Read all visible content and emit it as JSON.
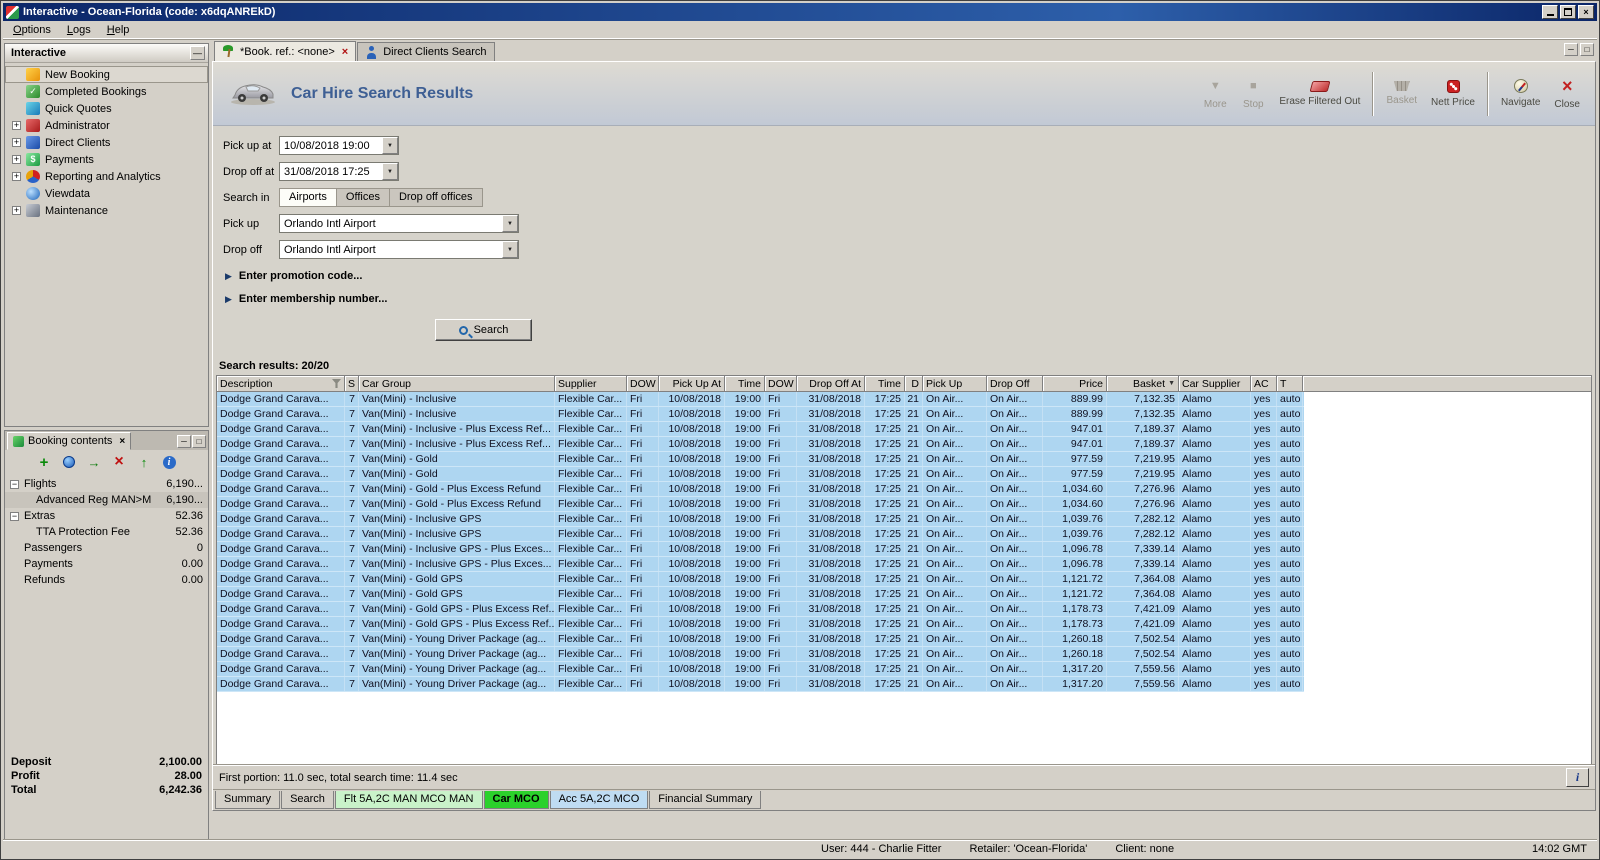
{
  "titlebar": {
    "title": "Interactive - Ocean-Florida (code: x6dqANREkD)"
  },
  "menubar": {
    "items": [
      "Options",
      "Logs",
      "Help"
    ]
  },
  "sidebar": {
    "title": "Interactive",
    "items": [
      {
        "label": "New Booking",
        "icon": "booking-icon",
        "expandable": false,
        "selected": true
      },
      {
        "label": "Completed Bookings",
        "icon": "completed-icon",
        "expandable": false
      },
      {
        "label": "Quick Quotes",
        "icon": "quotes-icon",
        "expandable": false
      },
      {
        "label": "Administrator",
        "icon": "admin-icon",
        "expandable": true
      },
      {
        "label": "Direct Clients",
        "icon": "clients-icon",
        "expandable": true
      },
      {
        "label": "Payments",
        "icon": "payments-icon",
        "expandable": true
      },
      {
        "label": "Reporting and Analytics",
        "icon": "reports-icon",
        "expandable": true
      },
      {
        "label": "Viewdata",
        "icon": "viewdata-icon",
        "expandable": false
      },
      {
        "label": "Maintenance",
        "icon": "maintenance-icon",
        "expandable": true
      }
    ]
  },
  "booking_contents": {
    "title": "Booking contents",
    "toolbar_icons": [
      "add-icon",
      "globe-icon",
      "export-icon",
      "delete-icon",
      "upload-icon",
      "info-icon"
    ],
    "rows": [
      {
        "label": "Flights",
        "value": "6,190...",
        "level": 0,
        "expander": true
      },
      {
        "label": "Advanced Reg MAN>M",
        "value": "6,190...",
        "level": 1,
        "selected": true
      },
      {
        "label": "Extras",
        "value": "52.36",
        "level": 0,
        "expander": true
      },
      {
        "label": "TTA Protection Fee",
        "value": "52.36",
        "level": 1
      },
      {
        "label": "Passengers",
        "value": "0",
        "level": 0
      },
      {
        "label": "Payments",
        "value": "0.00",
        "level": 0
      },
      {
        "label": "Refunds",
        "value": "0.00",
        "level": 0
      }
    ],
    "totals": [
      {
        "label": "Deposit",
        "value": "2,100.00"
      },
      {
        "label": "Profit",
        "value": "28.00"
      },
      {
        "label": "Total",
        "value": "6,242.36"
      }
    ]
  },
  "doc_tabs": [
    {
      "label": "*Book. ref.: <none>",
      "icon": "palm-icon",
      "active": true,
      "closable": true
    },
    {
      "label": "Direct Clients Search",
      "icon": "client-search-icon",
      "active": false,
      "closable": false
    }
  ],
  "header": {
    "title": "Car Hire Search Results",
    "toolbar": [
      {
        "label": "More",
        "icon": "more-icon",
        "disabled": true
      },
      {
        "label": "Stop",
        "icon": "stop-icon",
        "disabled": true
      },
      {
        "label": "Erase Filtered Out",
        "icon": "erase-filter-icon",
        "disabled": false,
        "sep_after": true
      },
      {
        "label": "Basket",
        "icon": "basket-icon",
        "disabled": true
      },
      {
        "label": "Nett Price",
        "icon": "nett-price-icon",
        "disabled": false,
        "sep_after": true
      },
      {
        "label": "Navigate",
        "icon": "navigate-icon",
        "disabled": false
      },
      {
        "label": "Close",
        "icon": "close-icon",
        "disabled": false
      }
    ]
  },
  "form": {
    "pickup_at": {
      "label": "Pick up at",
      "value": "10/08/2018 19:00"
    },
    "dropoff_at": {
      "label": "Drop off at",
      "value": "31/08/2018 17:25"
    },
    "search_in": {
      "label": "Search in",
      "tabs": [
        "Airports",
        "Offices",
        "Drop off offices"
      ],
      "active_tab": "Airports"
    },
    "pickup": {
      "label": "Pick up",
      "value": "Orlando Intl Airport"
    },
    "dropoff": {
      "label": "Drop off",
      "value": "Orlando Intl Airport"
    },
    "promotion_toggle": "Enter promotion code...",
    "membership_toggle": "Enter membership number...",
    "search_button": "Search"
  },
  "results": {
    "summary": "Search results: 20/20",
    "sort_column": "Basket",
    "columns": [
      "Description",
      "S",
      "Car Group",
      "Supplier",
      "DOW",
      "Pick Up At",
      "Time",
      "DOW",
      "Drop Off At",
      "Time",
      "D",
      "Pick Up",
      "Drop Off",
      "Price",
      "Basket",
      "Car Supplier",
      "AC",
      "T"
    ],
    "rows": [
      [
        "Dodge Grand Carava...",
        "7",
        "Van(Mini) - Inclusive",
        "Flexible Car...",
        "Fri",
        "10/08/2018",
        "19:00",
        "Fri",
        "31/08/2018",
        "17:25",
        "21",
        "On Air...",
        "On Air...",
        "889.99",
        "7,132.35",
        "Alamo",
        "yes",
        "auto"
      ],
      [
        "Dodge Grand Carava...",
        "7",
        "Van(Mini) - Inclusive",
        "Flexible Car...",
        "Fri",
        "10/08/2018",
        "19:00",
        "Fri",
        "31/08/2018",
        "17:25",
        "21",
        "On Air...",
        "On Air...",
        "889.99",
        "7,132.35",
        "Alamo",
        "yes",
        "auto"
      ],
      [
        "Dodge Grand Carava...",
        "7",
        "Van(Mini) - Inclusive - Plus Excess Ref...",
        "Flexible Car...",
        "Fri",
        "10/08/2018",
        "19:00",
        "Fri",
        "31/08/2018",
        "17:25",
        "21",
        "On Air...",
        "On Air...",
        "947.01",
        "7,189.37",
        "Alamo",
        "yes",
        "auto"
      ],
      [
        "Dodge Grand Carava...",
        "7",
        "Van(Mini) - Inclusive - Plus Excess Ref...",
        "Flexible Car...",
        "Fri",
        "10/08/2018",
        "19:00",
        "Fri",
        "31/08/2018",
        "17:25",
        "21",
        "On Air...",
        "On Air...",
        "947.01",
        "7,189.37",
        "Alamo",
        "yes",
        "auto"
      ],
      [
        "Dodge Grand Carava...",
        "7",
        "Van(Mini) - Gold",
        "Flexible Car...",
        "Fri",
        "10/08/2018",
        "19:00",
        "Fri",
        "31/08/2018",
        "17:25",
        "21",
        "On Air...",
        "On Air...",
        "977.59",
        "7,219.95",
        "Alamo",
        "yes",
        "auto"
      ],
      [
        "Dodge Grand Carava...",
        "7",
        "Van(Mini) - Gold",
        "Flexible Car...",
        "Fri",
        "10/08/2018",
        "19:00",
        "Fri",
        "31/08/2018",
        "17:25",
        "21",
        "On Air...",
        "On Air...",
        "977.59",
        "7,219.95",
        "Alamo",
        "yes",
        "auto"
      ],
      [
        "Dodge Grand Carava...",
        "7",
        "Van(Mini) - Gold - Plus Excess Refund",
        "Flexible Car...",
        "Fri",
        "10/08/2018",
        "19:00",
        "Fri",
        "31/08/2018",
        "17:25",
        "21",
        "On Air...",
        "On Air...",
        "1,034.60",
        "7,276.96",
        "Alamo",
        "yes",
        "auto"
      ],
      [
        "Dodge Grand Carava...",
        "7",
        "Van(Mini) - Gold - Plus Excess Refund",
        "Flexible Car...",
        "Fri",
        "10/08/2018",
        "19:00",
        "Fri",
        "31/08/2018",
        "17:25",
        "21",
        "On Air...",
        "On Air...",
        "1,034.60",
        "7,276.96",
        "Alamo",
        "yes",
        "auto"
      ],
      [
        "Dodge Grand Carava...",
        "7",
        "Van(Mini) - Inclusive GPS",
        "Flexible Car...",
        "Fri",
        "10/08/2018",
        "19:00",
        "Fri",
        "31/08/2018",
        "17:25",
        "21",
        "On Air...",
        "On Air...",
        "1,039.76",
        "7,282.12",
        "Alamo",
        "yes",
        "auto"
      ],
      [
        "Dodge Grand Carava...",
        "7",
        "Van(Mini) - Inclusive GPS",
        "Flexible Car...",
        "Fri",
        "10/08/2018",
        "19:00",
        "Fri",
        "31/08/2018",
        "17:25",
        "21",
        "On Air...",
        "On Air...",
        "1,039.76",
        "7,282.12",
        "Alamo",
        "yes",
        "auto"
      ],
      [
        "Dodge Grand Carava...",
        "7",
        "Van(Mini) - Inclusive GPS - Plus Exces...",
        "Flexible Car...",
        "Fri",
        "10/08/2018",
        "19:00",
        "Fri",
        "31/08/2018",
        "17:25",
        "21",
        "On Air...",
        "On Air...",
        "1,096.78",
        "7,339.14",
        "Alamo",
        "yes",
        "auto"
      ],
      [
        "Dodge Grand Carava...",
        "7",
        "Van(Mini) - Inclusive GPS - Plus Exces...",
        "Flexible Car...",
        "Fri",
        "10/08/2018",
        "19:00",
        "Fri",
        "31/08/2018",
        "17:25",
        "21",
        "On Air...",
        "On Air...",
        "1,096.78",
        "7,339.14",
        "Alamo",
        "yes",
        "auto"
      ],
      [
        "Dodge Grand Carava...",
        "7",
        "Van(Mini) - Gold GPS",
        "Flexible Car...",
        "Fri",
        "10/08/2018",
        "19:00",
        "Fri",
        "31/08/2018",
        "17:25",
        "21",
        "On Air...",
        "On Air...",
        "1,121.72",
        "7,364.08",
        "Alamo",
        "yes",
        "auto"
      ],
      [
        "Dodge Grand Carava...",
        "7",
        "Van(Mini) - Gold GPS",
        "Flexible Car...",
        "Fri",
        "10/08/2018",
        "19:00",
        "Fri",
        "31/08/2018",
        "17:25",
        "21",
        "On Air...",
        "On Air...",
        "1,121.72",
        "7,364.08",
        "Alamo",
        "yes",
        "auto"
      ],
      [
        "Dodge Grand Carava...",
        "7",
        "Van(Mini) - Gold GPS - Plus Excess Ref...",
        "Flexible Car...",
        "Fri",
        "10/08/2018",
        "19:00",
        "Fri",
        "31/08/2018",
        "17:25",
        "21",
        "On Air...",
        "On Air...",
        "1,178.73",
        "7,421.09",
        "Alamo",
        "yes",
        "auto"
      ],
      [
        "Dodge Grand Carava...",
        "7",
        "Van(Mini) - Gold GPS - Plus Excess Ref...",
        "Flexible Car...",
        "Fri",
        "10/08/2018",
        "19:00",
        "Fri",
        "31/08/2018",
        "17:25",
        "21",
        "On Air...",
        "On Air...",
        "1,178.73",
        "7,421.09",
        "Alamo",
        "yes",
        "auto"
      ],
      [
        "Dodge Grand Carava...",
        "7",
        "Van(Mini) - Young Driver Package (ag...",
        "Flexible Car...",
        "Fri",
        "10/08/2018",
        "19:00",
        "Fri",
        "31/08/2018",
        "17:25",
        "21",
        "On Air...",
        "On Air...",
        "1,260.18",
        "7,502.54",
        "Alamo",
        "yes",
        "auto"
      ],
      [
        "Dodge Grand Carava...",
        "7",
        "Van(Mini) - Young Driver Package (ag...",
        "Flexible Car...",
        "Fri",
        "10/08/2018",
        "19:00",
        "Fri",
        "31/08/2018",
        "17:25",
        "21",
        "On Air...",
        "On Air...",
        "1,260.18",
        "7,502.54",
        "Alamo",
        "yes",
        "auto"
      ],
      [
        "Dodge Grand Carava...",
        "7",
        "Van(Mini) - Young Driver Package (ag...",
        "Flexible Car...",
        "Fri",
        "10/08/2018",
        "19:00",
        "Fri",
        "31/08/2018",
        "17:25",
        "21",
        "On Air...",
        "On Air...",
        "1,317.20",
        "7,559.56",
        "Alamo",
        "yes",
        "auto"
      ],
      [
        "Dodge Grand Carava...",
        "7",
        "Van(Mini) - Young Driver Package (ag...",
        "Flexible Car...",
        "Fri",
        "10/08/2018",
        "19:00",
        "Fri",
        "31/08/2018",
        "17:25",
        "21",
        "On Air...",
        "On Air...",
        "1,317.20",
        "7,559.56",
        "Alamo",
        "yes",
        "auto"
      ]
    ]
  },
  "status_line": {
    "text": "First portion: 11.0 sec, total search time: 11.4 sec",
    "info_button": "i"
  },
  "bottom_tabs": [
    {
      "label": "Summary",
      "color": ""
    },
    {
      "label": "Search",
      "color": ""
    },
    {
      "label": "Flt 5A,2C MAN MCO MAN",
      "color": "#c9f2c9"
    },
    {
      "label": "Car MCO",
      "color": "#2bd12b",
      "active": true
    },
    {
      "label": "Acc 5A,2C MCO",
      "color": "#bfdcf2"
    },
    {
      "label": "Financial Summary",
      "color": ""
    }
  ],
  "statusbar": {
    "user": "User: 444 - Charlie Fitter",
    "retailer": "Retailer: 'Ocean-Florida'",
    "client": "Client: none",
    "time": "14:02 GMT"
  }
}
